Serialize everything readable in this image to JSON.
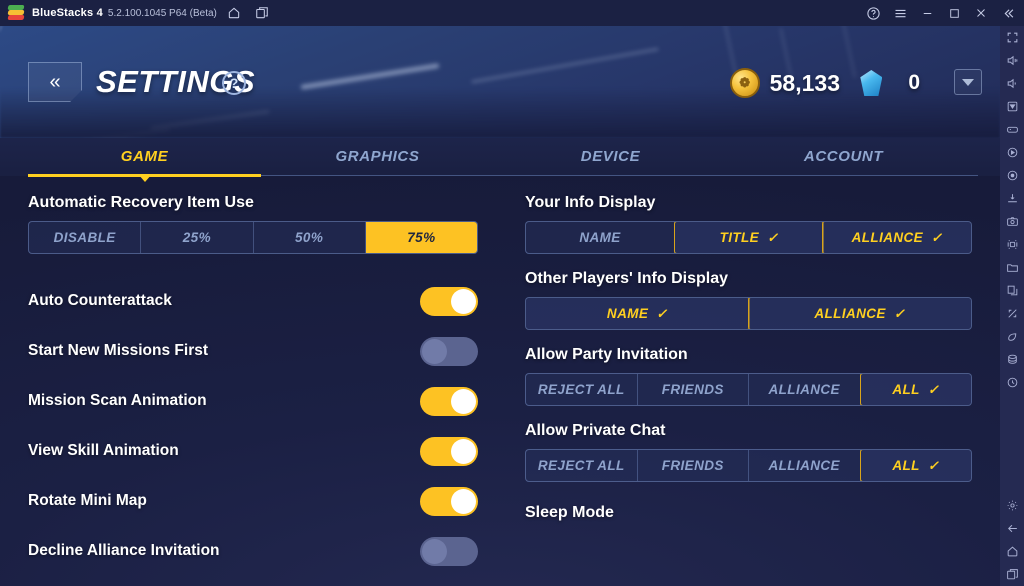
{
  "titlebar": {
    "app_name": "BlueStacks 4",
    "version": "5.2.100.1045 P64 (Beta)",
    "home_icon": "home-icon",
    "instances_icon": "multi-instance-icon",
    "help_icon": "help-icon",
    "menu_icon": "hamburger-menu-icon",
    "minimize_icon": "minimize-icon",
    "maximize_icon": "maximize-icon",
    "close_icon": "close-icon",
    "collapse_icon": "collapse-chevrons-icon"
  },
  "sidebar": {
    "items_top": [
      {
        "name": "fullscreen-icon"
      },
      {
        "name": "volume-up-icon"
      },
      {
        "name": "volume-down-icon"
      },
      {
        "name": "keymapping-icon"
      },
      {
        "name": "gamepad-icon"
      },
      {
        "name": "record-macro-icon"
      },
      {
        "name": "shake-icon"
      },
      {
        "name": "install-apk-icon"
      },
      {
        "name": "screenshot-icon"
      },
      {
        "name": "media-manager-icon"
      },
      {
        "name": "folder-icon"
      },
      {
        "name": "copy-to-clipboard-icon"
      },
      {
        "name": "rotate-icon"
      },
      {
        "name": "eco-mode-icon"
      },
      {
        "name": "disk-cleanup-icon"
      },
      {
        "name": "macro-recorder-icon"
      }
    ],
    "items_bottom": [
      {
        "name": "settings-gear-icon"
      },
      {
        "name": "back-arrow-icon"
      },
      {
        "name": "home-icon"
      },
      {
        "name": "recent-apps-icon"
      }
    ]
  },
  "header": {
    "back_label": "«",
    "title": "SETTINGS",
    "help_label": "?",
    "coin_glyph": "❁",
    "coin_value": "58,133",
    "gem_value": "0",
    "dropdown_icon": "chevron-down-icon"
  },
  "tabs": [
    {
      "label": "GAME",
      "active": true
    },
    {
      "label": "GRAPHICS",
      "active": false
    },
    {
      "label": "DEVICE",
      "active": false
    },
    {
      "label": "ACCOUNT",
      "active": false
    }
  ],
  "left_column": {
    "recovery": {
      "title": "Automatic Recovery Item Use",
      "options": [
        {
          "label": "DISABLE",
          "selected": false
        },
        {
          "label": "25%",
          "selected": false
        },
        {
          "label": "50%",
          "selected": false
        },
        {
          "label": "75%",
          "selected": true
        }
      ]
    },
    "toggles": [
      {
        "label": "Auto Counterattack",
        "on": true
      },
      {
        "label": "Start New Missions First",
        "on": false
      },
      {
        "label": "Mission Scan Animation",
        "on": true
      },
      {
        "label": "View Skill Animation",
        "on": true
      },
      {
        "label": "Rotate Mini Map",
        "on": true
      },
      {
        "label": "Decline Alliance Invitation",
        "on": false
      }
    ]
  },
  "right_column": {
    "your_info": {
      "title": "Your Info Display",
      "options": [
        {
          "label": "NAME",
          "selected": false
        },
        {
          "label": "TITLE",
          "selected": true
        },
        {
          "label": "ALLIANCE",
          "selected": true
        }
      ]
    },
    "other_info": {
      "title": "Other Players' Info Display",
      "options": [
        {
          "label": "NAME",
          "selected": true
        },
        {
          "label": "ALLIANCE",
          "selected": true
        }
      ]
    },
    "party_invite": {
      "title": "Allow Party Invitation",
      "options": [
        {
          "label": "REJECT ALL",
          "selected": false
        },
        {
          "label": "FRIENDS",
          "selected": false
        },
        {
          "label": "ALLIANCE",
          "selected": false
        },
        {
          "label": "ALL",
          "selected": true
        }
      ]
    },
    "private_chat": {
      "title": "Allow Private Chat",
      "options": [
        {
          "label": "REJECT ALL",
          "selected": false
        },
        {
          "label": "FRIENDS",
          "selected": false
        },
        {
          "label": "ALLIANCE",
          "selected": false
        },
        {
          "label": "ALL",
          "selected": true
        }
      ]
    },
    "sleep_mode": {
      "title": "Sleep Mode"
    }
  },
  "checkmark": "✓",
  "colors": {
    "accent_yellow": "#ffd020",
    "fill_yellow": "#fdc223",
    "muted_text": "#8fa3cc",
    "panel_bg": "#1b2044"
  }
}
